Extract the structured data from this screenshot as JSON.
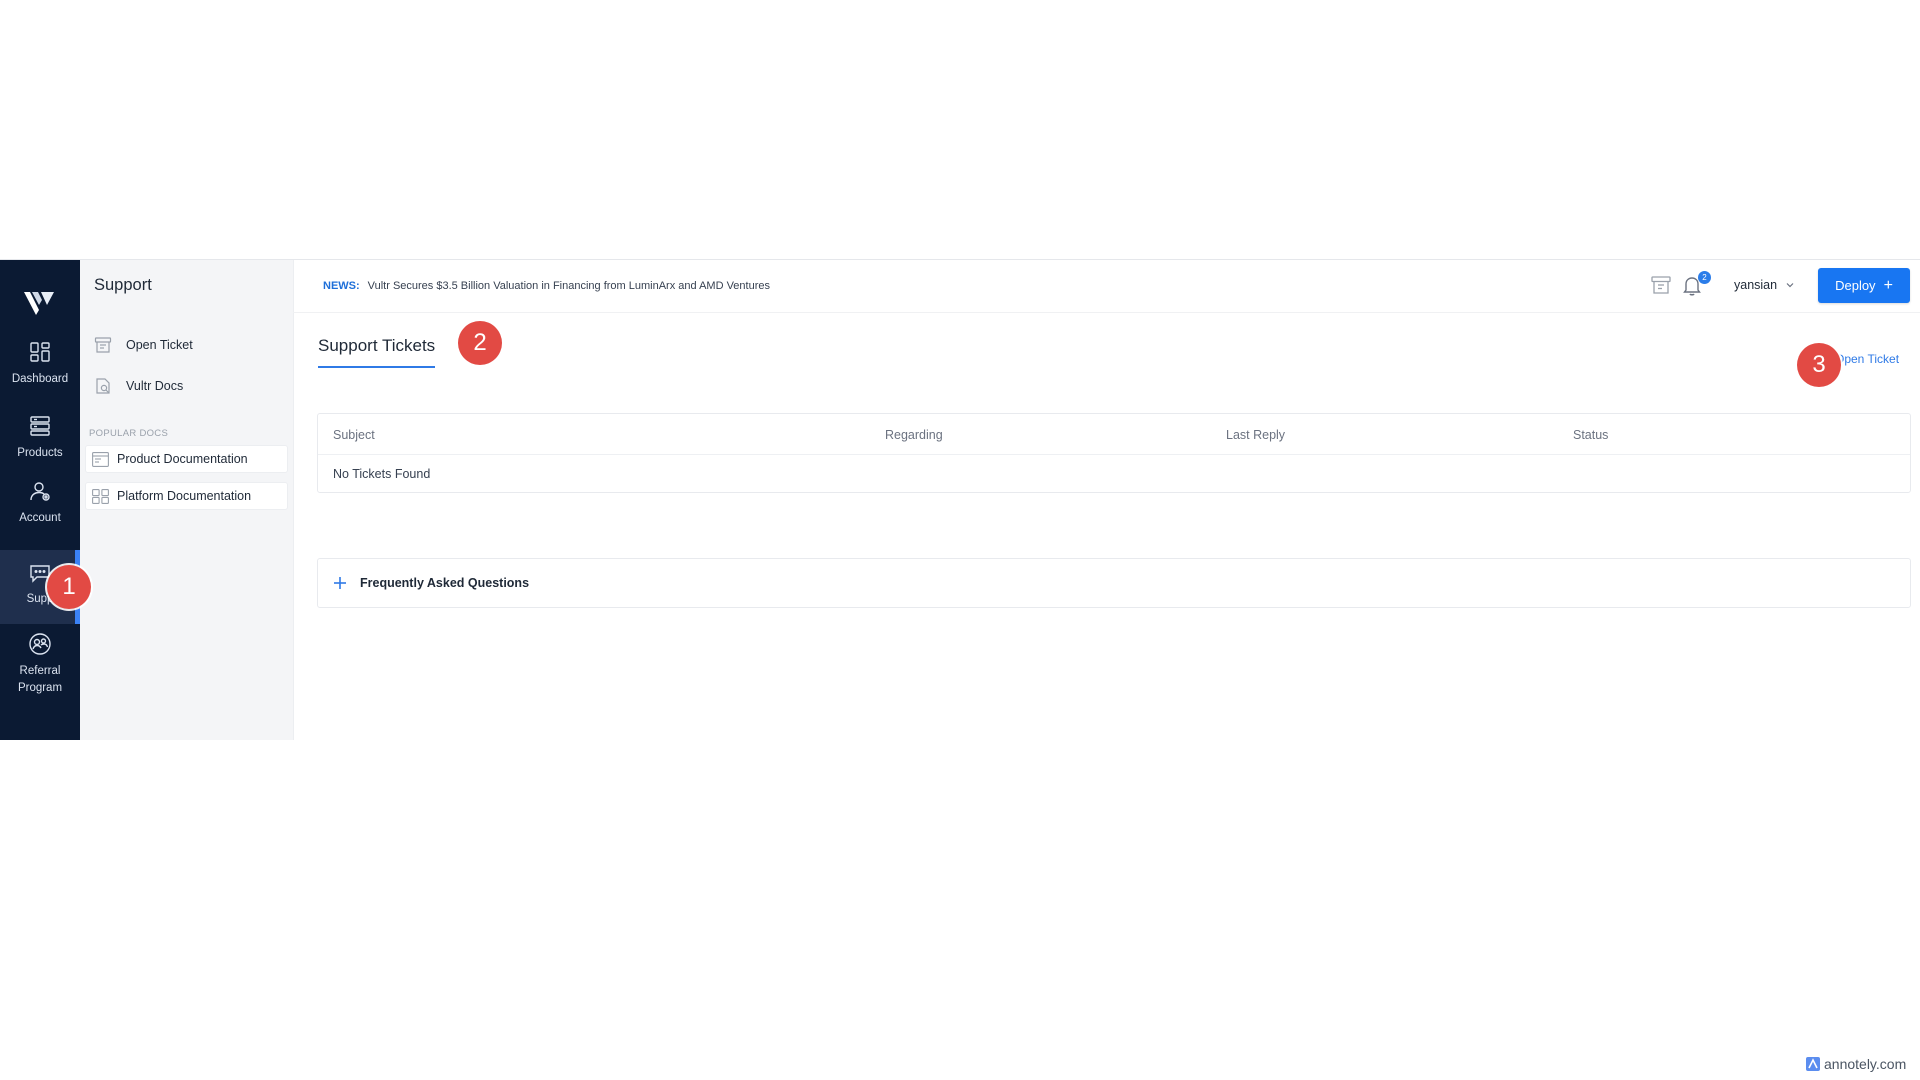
{
  "rail": {
    "items": [
      {
        "label": "Dashboard",
        "icon": "dashboard-icon"
      },
      {
        "label": "Products",
        "icon": "products-icon"
      },
      {
        "label": "Account",
        "icon": "account-icon"
      },
      {
        "label": "Supp",
        "icon": "support-icon",
        "active": true
      },
      {
        "label": "Referral\nProgram",
        "icon": "referral-icon"
      }
    ]
  },
  "subnav": {
    "title": "Support",
    "links": [
      {
        "label": "Open Ticket",
        "icon": "ticket-icon"
      },
      {
        "label": "Vultr Docs",
        "icon": "docs-icon"
      }
    ],
    "section_label": "POPULAR DOCS",
    "docs": [
      {
        "label": "Product Documentation",
        "icon": "product-docs-icon"
      },
      {
        "label": "Platform Documentation",
        "icon": "platform-docs-icon"
      }
    ]
  },
  "topbar": {
    "news_tag": "NEWS:",
    "news_text": "Vultr Secures $3.5 Billion Valuation in Financing from LuminArx and AMD Ventures",
    "notification_count": "2",
    "username": "yansian",
    "deploy_label": "Deploy"
  },
  "main": {
    "tab_label": "Support Tickets",
    "open_ticket_link": "Open Ticket",
    "table": {
      "columns": [
        "Subject",
        "Regarding",
        "Last Reply",
        "Status"
      ],
      "empty_text": "No Tickets Found"
    },
    "faq_label": "Frequently Asked Questions"
  },
  "markers": [
    "1",
    "2",
    "3"
  ],
  "watermark": "annotely.com",
  "colors": {
    "rail_bg": "#0b1a33",
    "accent": "#1876f2",
    "marker": "#e24a44"
  }
}
